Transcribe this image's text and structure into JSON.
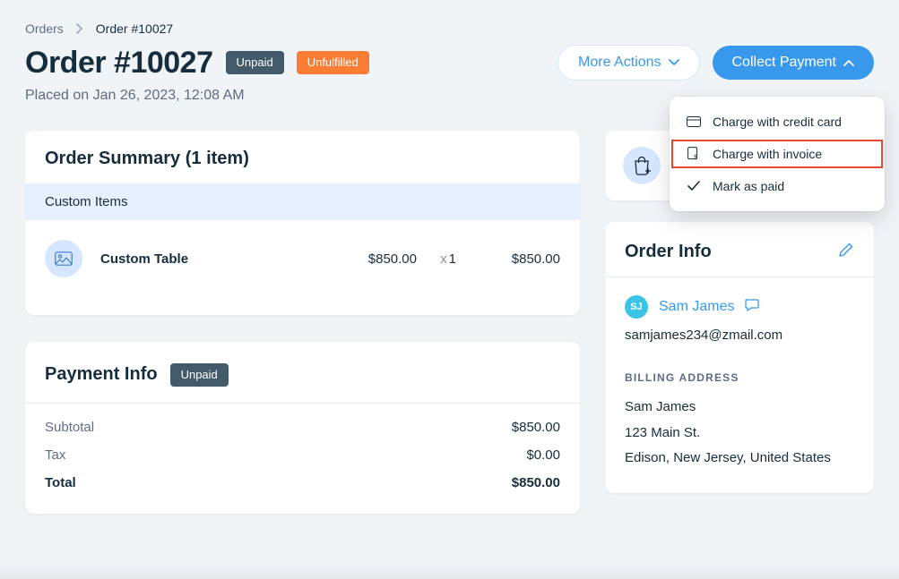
{
  "breadcrumb": {
    "root": "Orders",
    "current": "Order #10027"
  },
  "header": {
    "title": "Order #10027",
    "badge_unpaid": "Unpaid",
    "badge_unfulfilled": "Unfulfilled",
    "placed": "Placed on Jan 26, 2023, 12:08 AM",
    "more_actions": "More Actions",
    "collect_payment": "Collect Payment"
  },
  "dropdown": {
    "credit": "Charge with credit card",
    "invoice": "Charge with invoice",
    "mark_paid": "Mark as paid"
  },
  "summary": {
    "title": "Order Summary (1 item)",
    "subhead": "Custom Items",
    "item": {
      "name": "Custom Table",
      "price": "$850.00",
      "qty": "1",
      "line_total": "$850.00"
    }
  },
  "payment": {
    "title": "Payment Info",
    "badge": "Unpaid",
    "subtotal_label": "Subtotal",
    "subtotal": "$850.00",
    "tax_label": "Tax",
    "tax": "$0.00",
    "total_label": "Total",
    "total": "$850.00"
  },
  "info": {
    "title": "Order Info",
    "initials": "SJ",
    "customer": "Sam James",
    "email": "samjames234@zmail.com",
    "billing_label": "BILLING ADDRESS",
    "addr_name": "Sam James",
    "addr_street": "123 Main St.",
    "addr_city": "Edison, New Jersey, United States"
  }
}
